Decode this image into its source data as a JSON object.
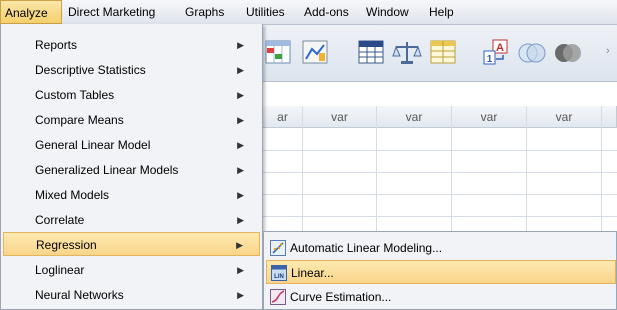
{
  "menubar": {
    "items": [
      {
        "label": "Analyze",
        "active": true
      },
      {
        "label": "Direct Marketing"
      },
      {
        "label": "Graphs"
      },
      {
        "label": "Utilities"
      },
      {
        "label": "Add-ons"
      },
      {
        "label": "Window"
      },
      {
        "label": "Help"
      }
    ]
  },
  "grid": {
    "headers": [
      "ar",
      "var",
      "var",
      "var",
      "var"
    ]
  },
  "analyze_menu": {
    "items": [
      {
        "label": "Reports"
      },
      {
        "label": "Descriptive Statistics"
      },
      {
        "label": "Custom Tables"
      },
      {
        "label": "Compare Means"
      },
      {
        "label": "General Linear Model"
      },
      {
        "label": "Generalized Linear Models"
      },
      {
        "label": "Mixed Models"
      },
      {
        "label": "Correlate"
      },
      {
        "label": "Regression",
        "highlighted": true
      },
      {
        "label": "Loglinear"
      },
      {
        "label": "Neural Networks"
      }
    ],
    "submenu_arrow": "▶"
  },
  "regression_submenu": {
    "items": [
      {
        "label": "Automatic Linear Modeling...",
        "icon": "automatic-linear-modeling-icon"
      },
      {
        "label": "Linear...",
        "icon": "linear-regression-icon",
        "highlighted": true
      },
      {
        "label": "Curve Estimation...",
        "icon": "curve-estimation-icon"
      }
    ]
  },
  "colors": {
    "highlight": "#f9d58a",
    "menu_bg": "#f1f3f6",
    "menubar_bg": "#dfe4ec"
  }
}
